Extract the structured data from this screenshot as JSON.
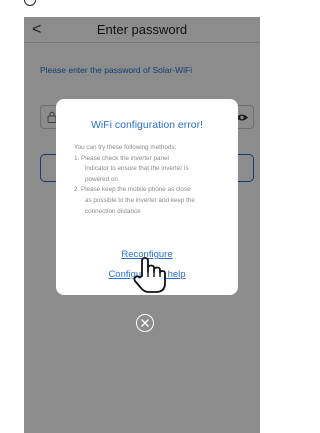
{
  "header": {
    "title": "Enter password",
    "back_icon": "chevron-left-icon"
  },
  "form": {
    "instruction": "Please enter the password of Solar-WiFi",
    "password_value": "",
    "lock_icon": "lock-icon",
    "visibility_icon": "eye-icon"
  },
  "dialog": {
    "title": "WiFi configuration error!",
    "intro": "You can try these following methods:",
    "step1_lines": [
      "1. Please check the inverter panel",
      "indicator to ensure that the inverter is",
      "powered on"
    ],
    "step2_lines": [
      "2. Please keep the mobile phone as close",
      "as possible to the inverter and keep the",
      "connection distance"
    ],
    "reconfigure_label": "Reconfigure",
    "help_label": "Configuration help",
    "close_icon": "close-circle-icon"
  },
  "colors": {
    "accent": "#2a6fd6",
    "overlay": "rgba(0,0,0,0.45)",
    "body_text": "#8a8a8a"
  }
}
